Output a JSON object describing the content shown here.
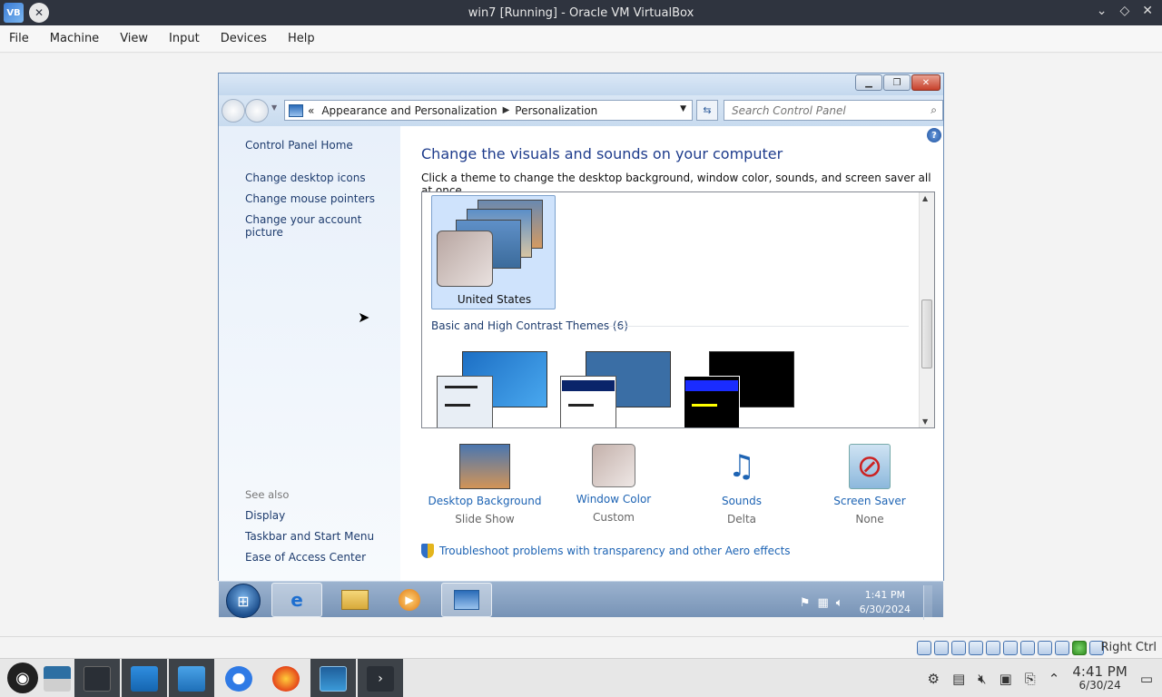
{
  "host": {
    "window_title": "win7 [Running] - Oracle VM VirtualBox",
    "menu": [
      "File",
      "Machine",
      "View",
      "Input",
      "Devices",
      "Help"
    ],
    "status_right": "Right Ctrl",
    "clock_time": "4:41 PM",
    "clock_date": "6/30/24"
  },
  "win7": {
    "address": {
      "chevron": "«",
      "crumbs": [
        "Appearance and Personalization",
        "Personalization"
      ]
    },
    "search_placeholder": "Search Control Panel",
    "left_nav": {
      "home": "Control Panel Home",
      "links": [
        "Change desktop icons",
        "Change mouse pointers",
        "Change your account picture"
      ],
      "see_also_label": "See also",
      "see_also": [
        "Display",
        "Taskbar and Start Menu",
        "Ease of Access Center"
      ]
    },
    "main": {
      "title": "Change the visuals and sounds on your computer",
      "subtitle": "Click a theme to change the desktop background, window color, sounds, and screen saver all at once.",
      "selected_theme": "United States",
      "group_header": "Basic and High Contrast Themes (6)",
      "options": [
        {
          "label": "Desktop Background",
          "value": "Slide Show",
          "icon": "desktop-background-icon"
        },
        {
          "label": "Window Color",
          "value": "Custom",
          "icon": "window-color-icon"
        },
        {
          "label": "Sounds",
          "value": "Delta",
          "icon": "sounds-icon"
        },
        {
          "label": "Screen Saver",
          "value": "None",
          "icon": "screen-saver-icon"
        }
      ],
      "troubleshoot": "Troubleshoot problems with transparency and other Aero effects"
    },
    "taskbar": {
      "clock_time": "1:41 PM",
      "clock_date": "6/30/2024"
    }
  },
  "colors": {
    "link": "#1e64b4",
    "title_blue": "#1e3c8c",
    "host_titlebar": "#2f343f",
    "selection": "#cfe3fc"
  }
}
